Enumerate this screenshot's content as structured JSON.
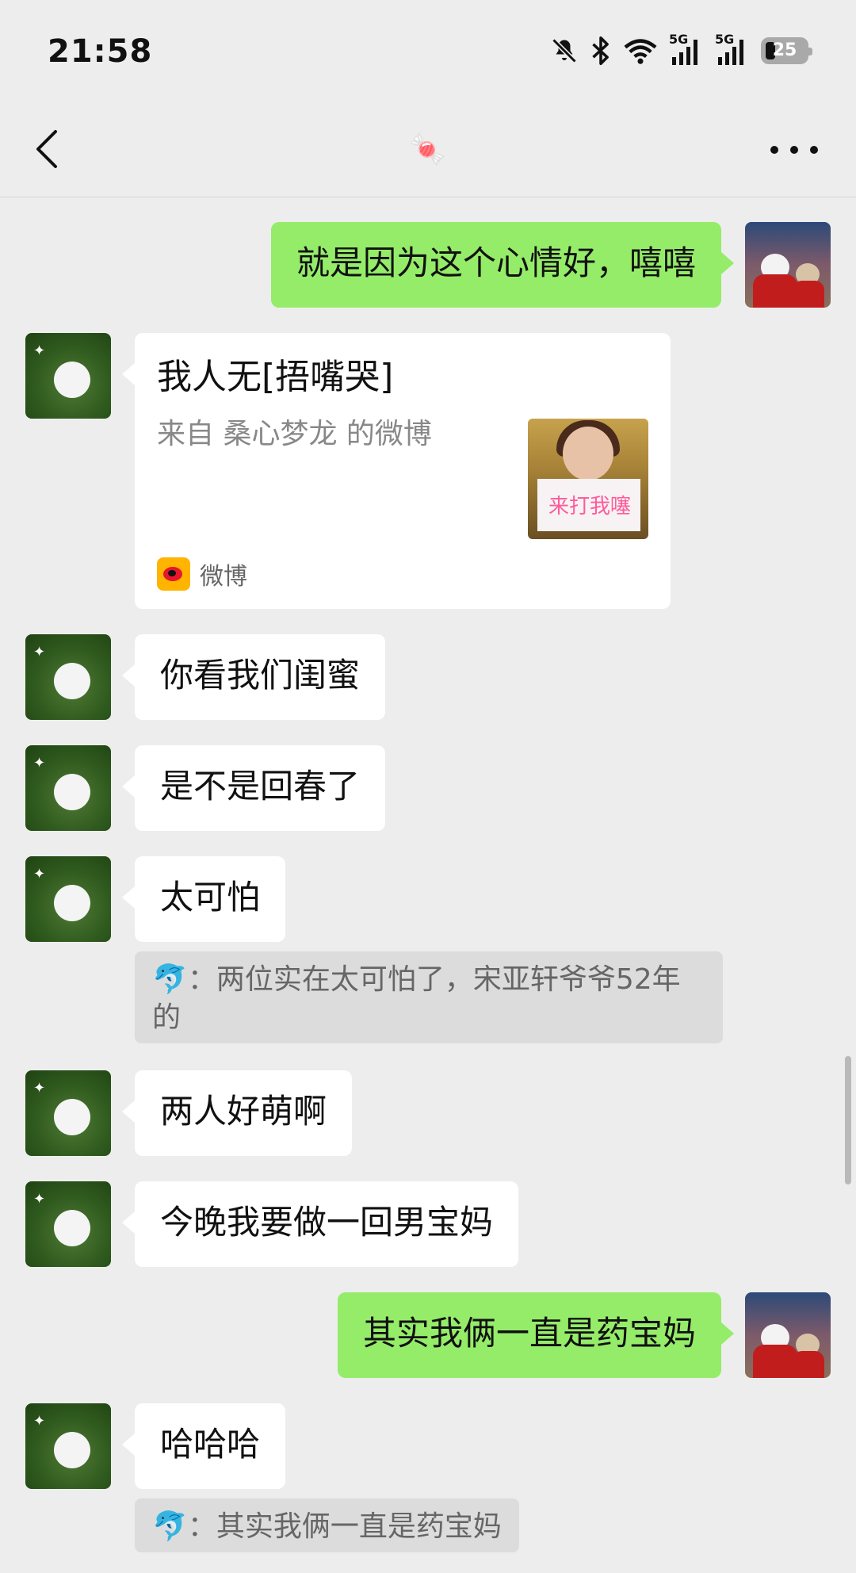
{
  "status_bar": {
    "time": "21:58",
    "network_1": "5G",
    "network_2": "5G",
    "battery": "25"
  },
  "nav": {
    "title": "🍬"
  },
  "messages": [
    {
      "from": "self",
      "text": "就是因为这个心情好，嘻嘻"
    },
    {
      "from": "other",
      "type": "link_card",
      "title": "我人无[捂嘴哭]",
      "description": "来自 桑心梦龙 的微博",
      "thumbnail_text": "来打我噻",
      "source": "微博"
    },
    {
      "from": "other",
      "text": "你看我们闺蜜"
    },
    {
      "from": "other",
      "text": "是不是回春了"
    },
    {
      "from": "other",
      "text": "太可怕",
      "quote": "🐬：两位实在太可怕了，宋亚轩爷爷52年的"
    },
    {
      "from": "other",
      "text": "两人好萌啊"
    },
    {
      "from": "other",
      "text": "今晚我要做一回男宝妈"
    },
    {
      "from": "self",
      "text": "其实我俩一直是药宝妈"
    },
    {
      "from": "other",
      "text": "哈哈哈",
      "quote": "🐬：其实我俩一直是药宝妈"
    }
  ],
  "colors": {
    "background": "#ededed",
    "self_bubble": "#95ec69",
    "other_bubble": "#ffffff",
    "quote_bg": "#dcdcdc"
  },
  "icons": [
    "mute-bell-icon",
    "bluetooth-icon",
    "wifi-icon",
    "signal-icon",
    "battery-icon",
    "back-icon",
    "more-icon",
    "weibo-icon"
  ]
}
